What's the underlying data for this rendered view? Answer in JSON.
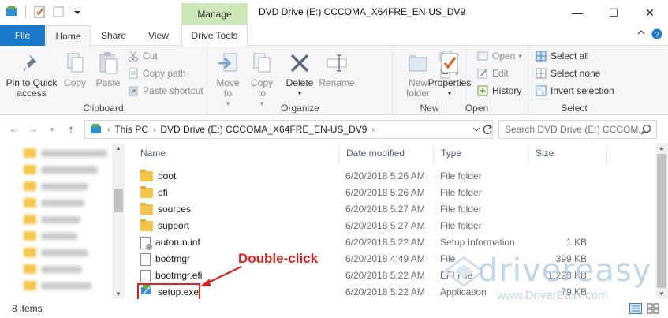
{
  "window": {
    "title": "DVD Drive (E:) CCCOMA_X64FRE_EN-US_DV9",
    "context_tab_group": "Manage",
    "controls": {
      "minimize": "—",
      "maximize": "☐",
      "close": "✕"
    }
  },
  "ribbon_tabs": {
    "file": "File",
    "home": "Home",
    "share": "Share",
    "view": "View",
    "drive_tools": "Drive Tools"
  },
  "ribbon": {
    "clipboard": {
      "label": "Clipboard",
      "pin": "Pin to Quick access",
      "copy": "Copy",
      "paste": "Paste",
      "cut": "Cut",
      "copy_path": "Copy path",
      "paste_shortcut": "Paste shortcut"
    },
    "organize": {
      "label": "Organize",
      "move_to": "Move to",
      "copy_to": "Copy to",
      "delete": "Delete",
      "rename": "Rename"
    },
    "new": {
      "label": "New",
      "new_folder": "New folder"
    },
    "open": {
      "label": "Open",
      "properties": "Properties",
      "open": "Open",
      "edit": "Edit",
      "history": "History"
    },
    "select": {
      "label": "Select",
      "select_all": "Select all",
      "select_none": "Select none",
      "invert_selection": "Invert selection"
    }
  },
  "address": {
    "path": [
      "This PC",
      "DVD Drive (E:) CCCOMA_X64FRE_EN-US_DV9"
    ],
    "search_placeholder": "Search DVD Drive (E:) CCCOM..."
  },
  "columns": {
    "name": "Name",
    "date": "Date modified",
    "type": "Type",
    "size": "Size"
  },
  "files": [
    {
      "name": "boot",
      "date": "6/20/2018 5:26 AM",
      "type": "File folder",
      "size": "",
      "icon": "folder-icon"
    },
    {
      "name": "efi",
      "date": "6/20/2018 5:26 AM",
      "type": "File folder",
      "size": "",
      "icon": "folder-icon"
    },
    {
      "name": "sources",
      "date": "6/20/2018 5:27 AM",
      "type": "File folder",
      "size": "",
      "icon": "folder-icon"
    },
    {
      "name": "support",
      "date": "6/20/2018 5:27 AM",
      "type": "File folder",
      "size": "",
      "icon": "folder-icon"
    },
    {
      "name": "autorun.inf",
      "date": "6/20/2018 5:22 AM",
      "type": "Setup Information",
      "size": "1 KB",
      "icon": "setup-info-icon"
    },
    {
      "name": "bootmgr",
      "date": "6/20/2018 4:49 AM",
      "type": "File",
      "size": "399 KB",
      "icon": "file-icon"
    },
    {
      "name": "bootmgr.efi",
      "date": "6/20/2018 5:22 AM",
      "type": "EFI File",
      "size": "1,228 KB",
      "icon": "file-icon"
    },
    {
      "name": "setup.exe",
      "date": "6/20/2018 5:22 AM",
      "type": "Application",
      "size": "79 KB",
      "icon": "setup-app-icon"
    }
  ],
  "status": {
    "item_count": "8 items"
  },
  "annotation": {
    "text": "Double-click"
  },
  "watermark": {
    "brand": "drivereasy",
    "url": "www.DriverEasy.com"
  },
  "colors": {
    "file_tab": "#1979ca",
    "manage_tab": "#cfe8b9",
    "annotation": "#e0201f",
    "watermark": "#bfd6e9"
  }
}
